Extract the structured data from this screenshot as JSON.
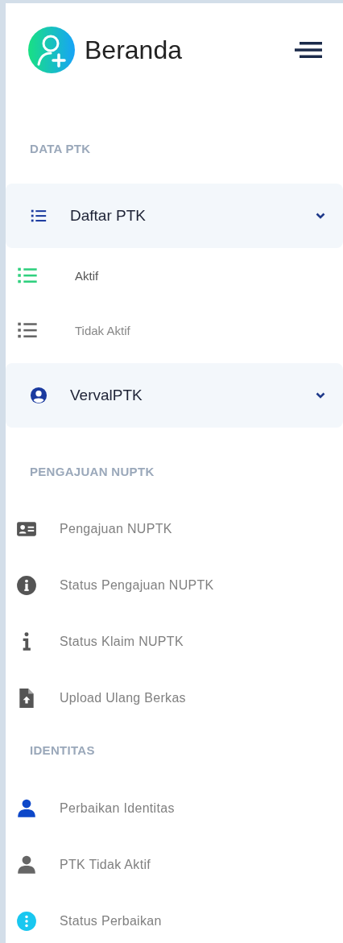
{
  "header": {
    "title": "Beranda"
  },
  "sections": [
    {
      "title": "DATA PTK",
      "items": [
        {
          "kind": "group",
          "label": "Daftar PTK",
          "children": [
            {
              "label": "Aktif",
              "selected": true
            },
            {
              "label": "Tidak Aktif",
              "selected": false
            }
          ]
        },
        {
          "kind": "group",
          "label": "VervalPTK"
        }
      ]
    },
    {
      "title": "PENGAJUAN NUPTK",
      "items": [
        {
          "kind": "link",
          "label": "Pengajuan NUPTK",
          "color": "#555555"
        },
        {
          "kind": "link",
          "label": "Status Pengajuan NUPTK",
          "color": "#555555"
        },
        {
          "kind": "link",
          "label": "Status Klaim NUPTK",
          "color": "#555555"
        },
        {
          "kind": "link",
          "label": "Upload Ulang Berkas",
          "color": "#555555"
        }
      ]
    },
    {
      "title": "IDENTITAS",
      "items": [
        {
          "kind": "link",
          "label": "Perbaikan Identitas",
          "color": "#0d47c9"
        },
        {
          "kind": "link",
          "label": "PTK Tidak Aktif",
          "color": "#666666"
        },
        {
          "kind": "link",
          "label": "Status Perbaikan",
          "color": "#19c7f0"
        }
      ]
    }
  ]
}
